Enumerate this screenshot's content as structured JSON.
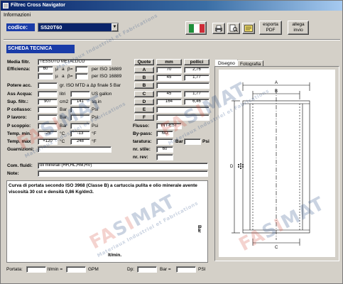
{
  "window": {
    "title": "Filtrec Cross Navigator"
  },
  "menu": {
    "informazioni": "Informazioni"
  },
  "codice": {
    "label": "codice:",
    "value": "S520T60",
    "dropdown_glyph": "▼"
  },
  "toolbar": {
    "esporta_line1": "esporta",
    "esporta_line2": "PDF",
    "allega_line1": "allega",
    "allega_line2": "invio"
  },
  "section": {
    "title": "SCHEDA TECNICA"
  },
  "fields": {
    "media_label": "Media filtr.",
    "media_value": "TESSUTO METALLICO",
    "efficienza_label": "Efficienza:",
    "eff1_value": "60",
    "eff1_mu": "µ",
    "eff1_a": "a",
    "eff1_beta": "β=",
    "eff1_std": "per ISO 16889",
    "eff2_mu": "µ",
    "eff2_a": "a",
    "eff2_beta": "β=",
    "eff2_std": "per ISO 16889",
    "potere_label": "Potere acc.",
    "potere_note": "gr. ISO MTD a Δp finale 5 Bar",
    "ass_label": "Ass Acqua:",
    "ass_unit1": "litri",
    "ass_unit2": "US gallon",
    "sup_label": "Sup. filtr.:",
    "sup_value1": "907",
    "sup_unit1": "cm2",
    "sup_value2": "141",
    "sup_unit2": "sq.in",
    "pcollasso_label": "P collasso:",
    "pcollasso_unit1": "Bar",
    "pcollasso_unit2": "Psi",
    "plavoro_label": "P lavoro:",
    "plavoro_unit1": "Bar",
    "plavoro_unit2": "Psi",
    "pscoppio_label": "P scoppio:",
    "pscoppio_unit1": "Bar",
    "pscoppio_unit2": "Psi",
    "tmin_label": "Temp. min.",
    "tmin_c": "-25",
    "tmin_c_unit": "°C",
    "tmin_f": "-13",
    "tmin_f_unit": "°F",
    "tmax_label": "Temp. max",
    "tmax_c": "+120",
    "tmax_c_unit": "°C",
    "tmax_f": "248",
    "tmax_f_unit": "°F",
    "guarnizioni_label": "Guarnizioni:",
    "fluidi_label": "Com. fluidi:",
    "fluidi_value": "oli minerali (HH,HL,HM,HV)",
    "note_label": "Note:"
  },
  "quote": {
    "header": "Quote",
    "col_mm": "mm",
    "col_pollici": "pollici",
    "rows": [
      {
        "key": "A",
        "mm": "70",
        "in": "2,76"
      },
      {
        "key": "B",
        "mm": "45",
        "in": "1,77"
      },
      {
        "key": "B",
        "mm": "",
        "in": ""
      },
      {
        "key": "C",
        "mm": "45",
        "in": "1,77"
      },
      {
        "key": "D",
        "mm": "164",
        "in": "6,46"
      },
      {
        "key": "E",
        "mm": "",
        "in": ""
      },
      {
        "key": "F",
        "mm": "",
        "in": ""
      }
    ]
  },
  "right_fields": {
    "flusso_label": "Flusso:",
    "flusso_value": "INT-EST",
    "bypass_label": "By-pass:",
    "bypass_value": "NO",
    "taratura_label": "taratura:",
    "taratura_unit1": "Bar",
    "taratura_unit2": "Psi",
    "stile_label": "nr. stile:",
    "stile_value": "60",
    "rev_label": "nr. rev:"
  },
  "tabs": {
    "disegno": "Disegno",
    "fotografia": "Fotografia"
  },
  "drawing": {
    "labels": {
      "a": "A",
      "b": "B",
      "c": "C",
      "d": "D"
    }
  },
  "curve": {
    "text": "Curva di portata secondo ISO 3968 (Classe B) a cartuccia pulita e olio minerale avente viscosità 30 cst e densità 0,86 Kg/dm3.",
    "ylabel": "Bar",
    "xlabel": "lt/min."
  },
  "status": {
    "portata_label": "Portata:",
    "ltmin_label": "lt/min =",
    "gpm_label": "GPM",
    "dp_label": "Dp:",
    "bar_label": "Bar =",
    "psi_label": "PSI"
  },
  "watermark": {
    "brand_red": "FA",
    "brand_blue_1": "S",
    "brand_red_2": "I",
    "brand_blue_2": "MAT",
    "sub1": "Matériaux Industriel et Fabrications",
    "sub2": "Materiaux Industriel et Fabrications"
  },
  "colors": {
    "accent": "#1a3ca8",
    "title_bar": "#0a246a",
    "watermark_red": "#d23b2a",
    "watermark_blue": "#123a7a"
  }
}
